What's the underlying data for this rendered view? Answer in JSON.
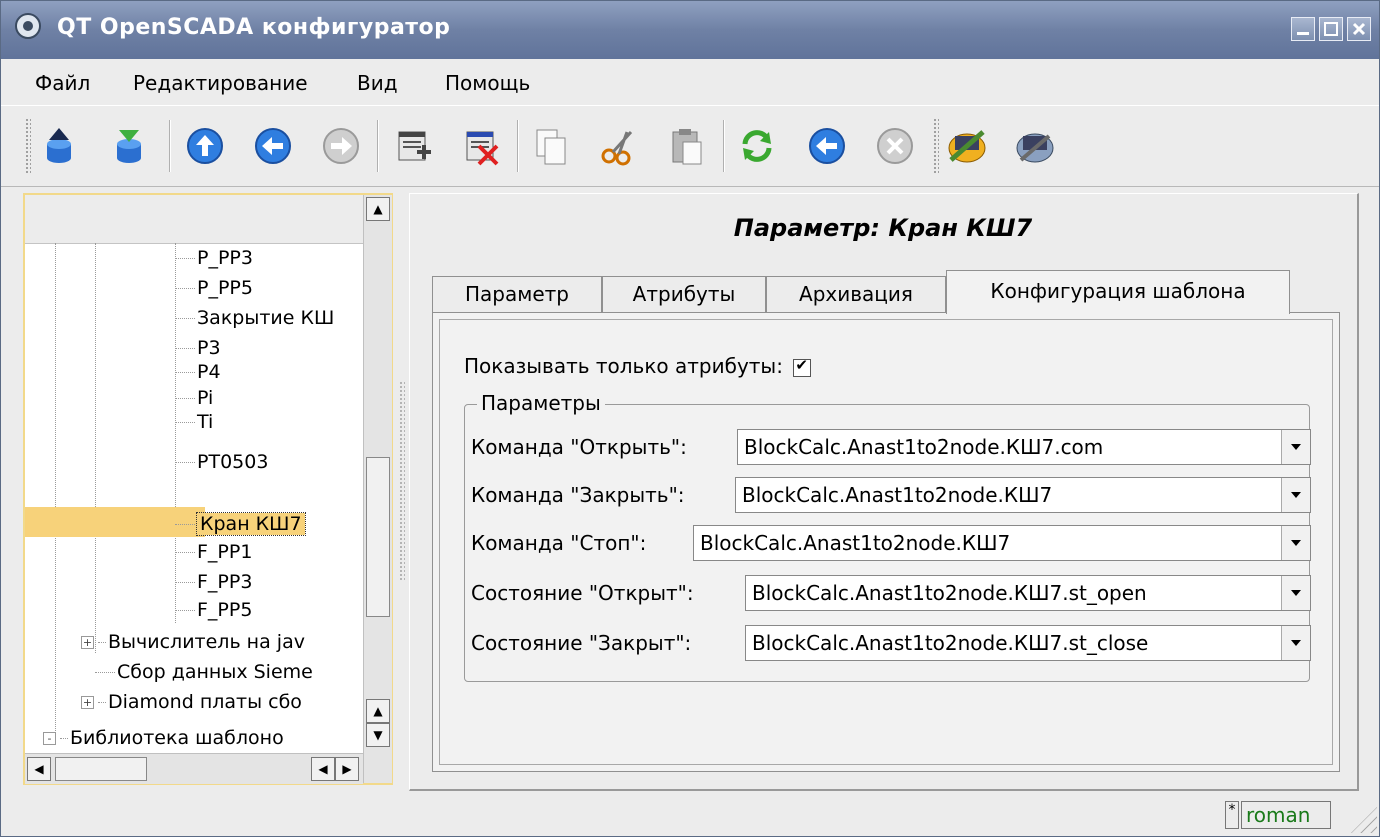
{
  "window": {
    "title": "QT OpenSCADA конфигуратор"
  },
  "menu": [
    {
      "label": "Файл"
    },
    {
      "label": "Редактирование"
    },
    {
      "label": "Вид"
    },
    {
      "label": "Помощь"
    }
  ],
  "toolbar": {
    "buttons": [
      {
        "icon": "db-load-icon"
      },
      {
        "icon": "db-save-icon"
      },
      {
        "icon": "up-icon"
      },
      {
        "icon": "back-icon"
      },
      {
        "icon": "forward-icon"
      },
      {
        "icon": "add-item-icon"
      },
      {
        "icon": "delete-item-icon"
      },
      {
        "icon": "copy-icon"
      },
      {
        "icon": "cut-icon"
      },
      {
        "icon": "paste-icon"
      },
      {
        "icon": "refresh-icon"
      },
      {
        "icon": "start-icon"
      },
      {
        "icon": "stop-icon"
      },
      {
        "icon": "station-module-icon"
      },
      {
        "icon": "station-config-icon"
      }
    ]
  },
  "tree": {
    "items": [
      {
        "label": "P_PP3"
      },
      {
        "label": "P_PP5"
      },
      {
        "label": "Закрытие КШ"
      },
      {
        "label": "P3"
      },
      {
        "label": "P4"
      },
      {
        "label": "Pi"
      },
      {
        "label": "Ti"
      },
      {
        "label": "PT0503"
      },
      {
        "label": "Кран КШ7",
        "selected": true
      },
      {
        "label": "F_PP1"
      },
      {
        "label": "F_PP3"
      },
      {
        "label": "F_PP5"
      },
      {
        "label": "Вычислитель на jav",
        "expander": "+"
      },
      {
        "label": "Сбор данных Sieme"
      },
      {
        "label": "Diamond платы сбо",
        "expander": "+"
      },
      {
        "label": "Библиотека шаблоно",
        "expander": "-"
      }
    ]
  },
  "page": {
    "title": "Параметр: Кран КШ7",
    "tabs": [
      {
        "label": "Параметр"
      },
      {
        "label": "Атрибуты"
      },
      {
        "label": "Архивация"
      },
      {
        "label": "Конфигурация шаблона",
        "active": true
      }
    ],
    "show_attr_label": "Показывать только атрибуты:",
    "show_attr_checked": true,
    "group_title": "Параметры",
    "fields": [
      {
        "label": "Команда \"Открыть\":",
        "value": "BlockCalc.Anast1to2node.КШ7.com"
      },
      {
        "label": "Команда \"Закрыть\":",
        "value": "BlockCalc.Anast1to2node.КШ7"
      },
      {
        "label": "Команда \"Стоп\":",
        "value": "BlockCalc.Anast1to2node.КШ7"
      },
      {
        "label": "Состояние \"Открыт\":",
        "value": "BlockCalc.Anast1to2node.КШ7.st_open"
      },
      {
        "label": "Состояние \"Закрыт\":",
        "value": "BlockCalc.Anast1to2node.КШ7.st_close"
      }
    ]
  },
  "status": {
    "modified": "*",
    "user": "roman"
  }
}
